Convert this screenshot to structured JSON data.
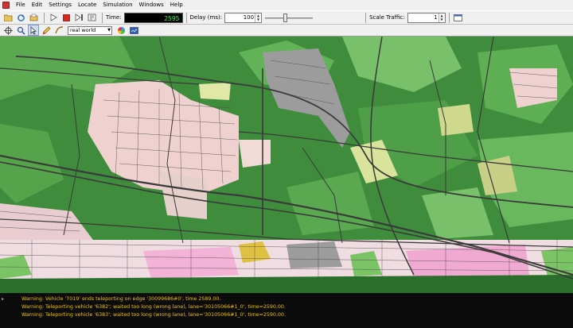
{
  "menu": {
    "items": [
      "File",
      "Edit",
      "Settings",
      "Locate",
      "Simulation",
      "Windows",
      "Help"
    ]
  },
  "toolbar": {
    "time_label": "Time:",
    "time_value": "2595",
    "delay_label": "Delay (ms):",
    "delay_value": "100",
    "delay_slider_fraction": 0.42,
    "scale_label": "Scale Traffic:",
    "scale_value": "1"
  },
  "view": {
    "scheme_value": "real world"
  },
  "icons": {
    "open": "open-folder-icon",
    "reload": "reload-icon",
    "save": "save-icon",
    "play": "play-icon",
    "stop": "stop-icon",
    "step": "step-icon",
    "snapshot": "snapshot-icon",
    "recenter": "recenter-icon",
    "locate": "locate-icon",
    "select": "select-mode-icon",
    "edit": "edit-mode-icon",
    "shape": "shape-icon",
    "colors": "color-wheel-icon",
    "screenshot": "screenshot-icon"
  },
  "colors": {
    "forest": "#3f8d3c",
    "park": "#7bc466",
    "residential": "#f2d6d6",
    "industrial": "#9b9b9b",
    "farmland": "#dfe6a2",
    "road": "#3a3a3a",
    "log_text": "#f0c000"
  },
  "log": {
    "lines": [
      "Warning: Vehicle '7019' ends teleporting on edge '30099686#0', time 2589.00.",
      "Warning: Teleporting vehicle '6382'; waited too long (wrong lane), lane='30105066#1_0', time=2590.00.",
      "Warning: Teleporting vehicle '6383'; waited too long (wrong lane), lane='30105066#1_0', time=2590.00."
    ]
  }
}
